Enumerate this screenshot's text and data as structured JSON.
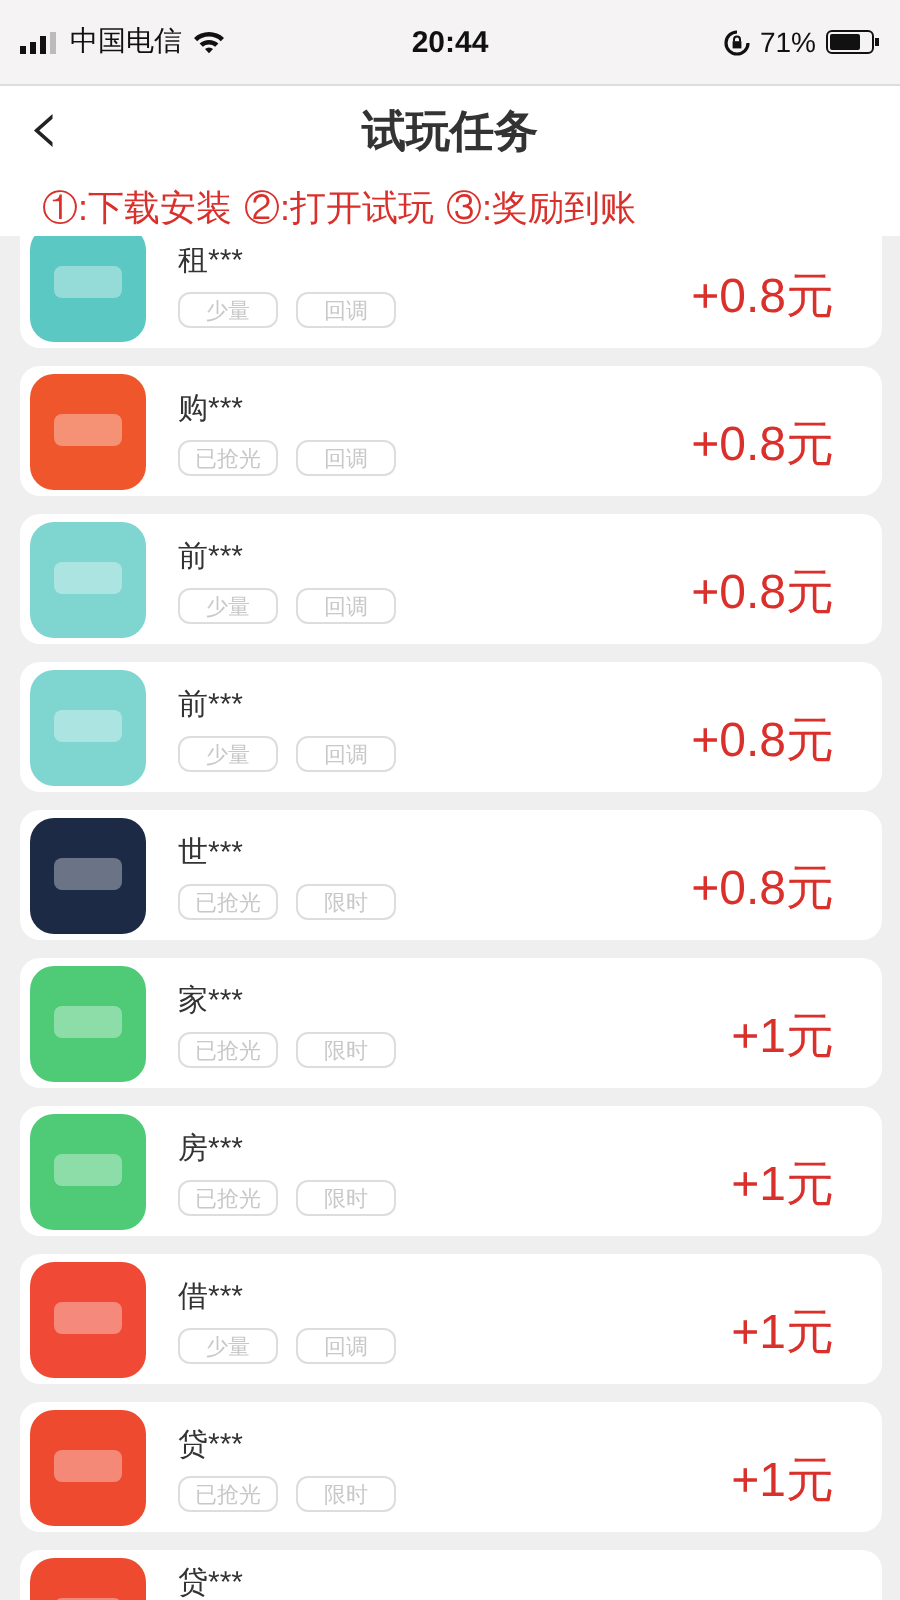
{
  "status_bar": {
    "carrier": "中国电信",
    "time": "20:44",
    "battery": "71%"
  },
  "nav": {
    "back": "‹",
    "title": "试玩任务"
  },
  "steps": [
    "①:下载安装",
    "②:打开试玩",
    "③:奖励到账"
  ],
  "tasks": [
    {
      "name": "租***",
      "tags": [
        "少量",
        "回调"
      ],
      "reward": "+0.8元",
      "color": "#5cc8c4"
    },
    {
      "name": "购***",
      "tags": [
        "已抢光",
        "回调"
      ],
      "reward": "+0.8元",
      "color": "#f0562c"
    },
    {
      "name": "前***",
      "tags": [
        "少量",
        "回调"
      ],
      "reward": "+0.8元",
      "color": "#7fd6d0"
    },
    {
      "name": "前***",
      "tags": [
        "少量",
        "回调"
      ],
      "reward": "+0.8元",
      "color": "#7fd6d0"
    },
    {
      "name": "世***",
      "tags": [
        "已抢光",
        "限时"
      ],
      "reward": "+0.8元",
      "color": "#1d2a45"
    },
    {
      "name": "家***",
      "tags": [
        "已抢光",
        "限时"
      ],
      "reward": "+1元",
      "color": "#4fcb78"
    },
    {
      "name": "房***",
      "tags": [
        "已抢光",
        "限时"
      ],
      "reward": "+1元",
      "color": "#4fcb78"
    },
    {
      "name": "借***",
      "tags": [
        "少量",
        "回调"
      ],
      "reward": "+1元",
      "color": "#f04a36"
    },
    {
      "name": "贷***",
      "tags": [
        "已抢光",
        "限时"
      ],
      "reward": "+1元",
      "color": "#ee4a30"
    },
    {
      "name": "贷***",
      "color": "#ee4a30"
    }
  ]
}
